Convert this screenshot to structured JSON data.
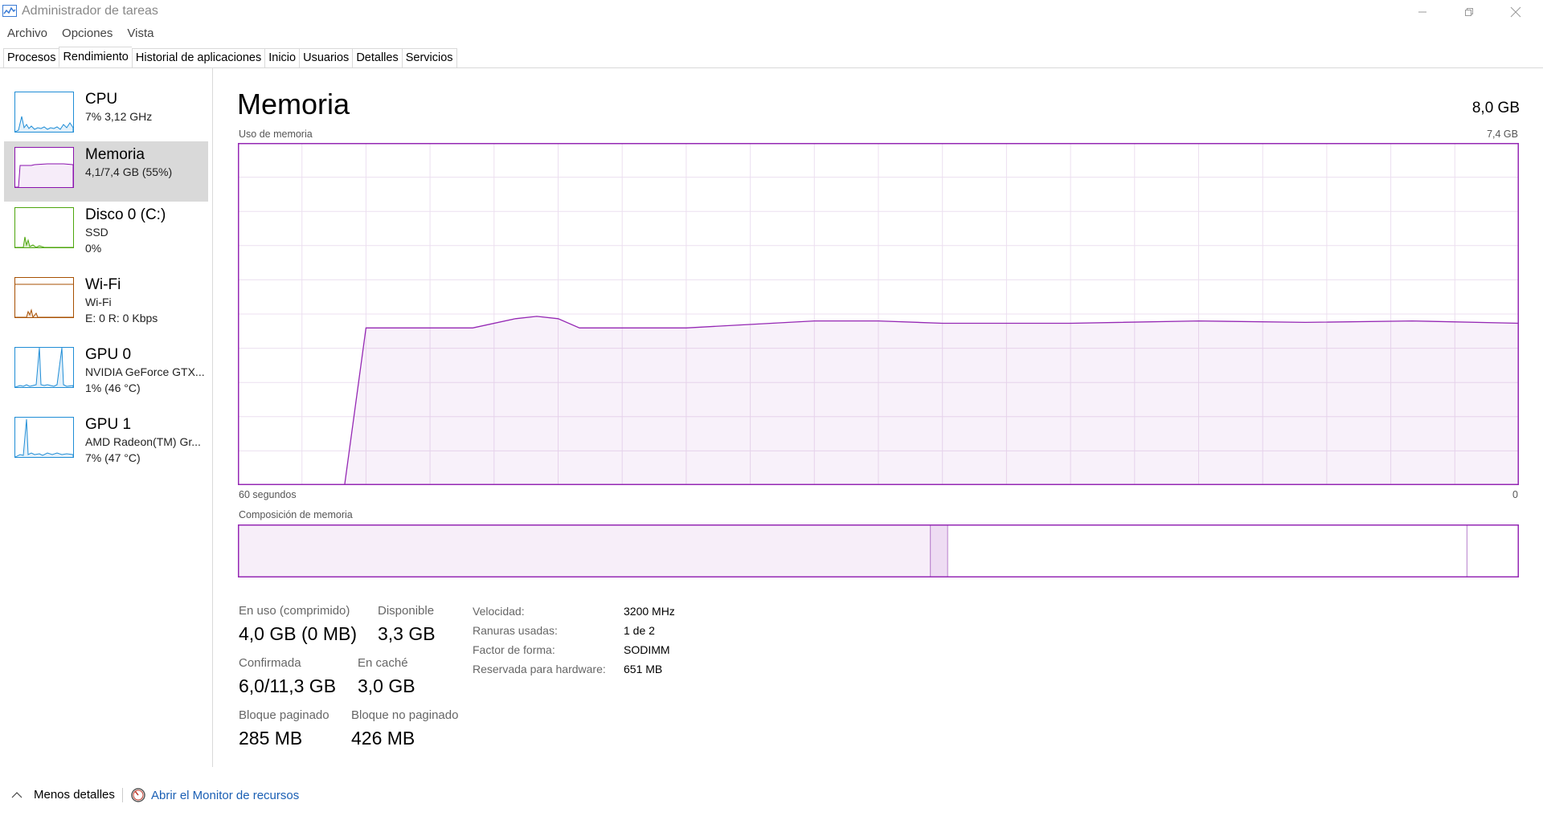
{
  "window": {
    "title": "Administrador de tareas"
  },
  "menu": {
    "items": [
      "Archivo",
      "Opciones",
      "Vista"
    ]
  },
  "tabs": [
    "Procesos",
    "Rendimiento",
    "Historial de aplicaciones",
    "Inicio",
    "Usuarios",
    "Detalles",
    "Servicios"
  ],
  "active_tab": "Rendimiento",
  "sidebar": {
    "items": [
      {
        "title": "CPU",
        "line1": "7% 3,12 GHz",
        "line2": "",
        "color": "#1f8dd6"
      },
      {
        "title": "Memoria",
        "line1": "4,1/7,4 GB (55%)",
        "line2": "",
        "color": "#8b12ae"
      },
      {
        "title": "Disco 0 (C:)",
        "line1": "SSD",
        "line2": "0%",
        "color": "#4da60c"
      },
      {
        "title": "Wi-Fi",
        "line1": "Wi-Fi",
        "line2": "E: 0 R: 0 Kbps",
        "color": "#a74f01"
      },
      {
        "title": "GPU 0",
        "line1": "NVIDIA GeForce GTX...",
        "line2": "1% (46 °C)",
        "color": "#1f8dd6"
      },
      {
        "title": "GPU 1",
        "line1": "AMD Radeon(TM) Gr...",
        "line2": "7% (47 °C)",
        "color": "#1f8dd6"
      }
    ]
  },
  "main": {
    "title": "Memoria",
    "total": "8,0 GB",
    "usage_label": "Uso de memoria",
    "usage_max": "7,4 GB",
    "time_left": "60 segundos",
    "time_right": "0",
    "composition_label": "Composición de memoria",
    "accent": "#8b12ae"
  },
  "stats": {
    "in_use_label": "En uso (comprimido)",
    "in_use_value": "4,0 GB (0 MB)",
    "available_label": "Disponible",
    "available_value": "3,3 GB",
    "committed_label": "Confirmada",
    "committed_value": "6,0/11,3 GB",
    "cached_label": "En caché",
    "cached_value": "3,0 GB",
    "paged_label": "Bloque paginado",
    "paged_value": "285 MB",
    "nonpaged_label": "Bloque no paginado",
    "nonpaged_value": "426 MB"
  },
  "info": {
    "speed_label": "Velocidad:",
    "speed_value": "3200 MHz",
    "slots_label": "Ranuras usadas:",
    "slots_value": "1 de 2",
    "form_label": "Factor de forma:",
    "form_value": "SODIMM",
    "reserved_label": "Reservada para hardware:",
    "reserved_value": "651 MB"
  },
  "footer": {
    "less_details": "Menos detalles",
    "resource_monitor": "Abrir el Monitor de recursos"
  },
  "chart_data": {
    "type": "area",
    "xlabel": "",
    "ylabel": "",
    "xlim": [
      60,
      0
    ],
    "ylim": [
      0,
      7.4
    ],
    "series": [
      {
        "x": [
          60,
          55,
          54,
          49,
          47,
          46,
          45,
          44,
          42,
          39,
          37,
          33,
          30,
          27,
          25,
          21,
          15,
          10,
          5,
          0
        ],
        "values": [
          0,
          0,
          3.4,
          3.4,
          3.6,
          3.65,
          3.6,
          3.4,
          3.4,
          3.4,
          3.45,
          3.55,
          3.55,
          3.5,
          3.5,
          3.5,
          3.55,
          3.52,
          3.55,
          3.5
        ]
      }
    ],
    "composition": {
      "in_use": 4.0,
      "modified": 0.1,
      "standby": 3.0,
      "free": 0.3,
      "total": 7.4
    }
  }
}
